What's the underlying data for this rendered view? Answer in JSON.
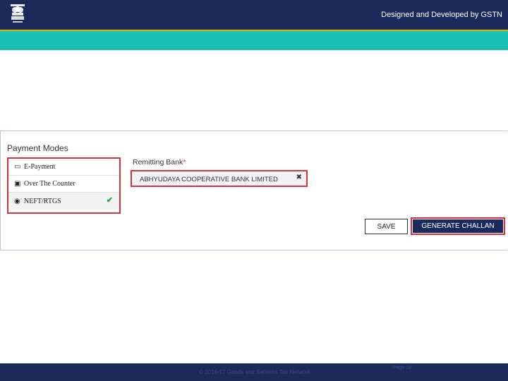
{
  "header": {
    "credit": "Designed and Developed by GSTN"
  },
  "payment": {
    "title": "Payment Modes",
    "modes": [
      {
        "icon": "card-icon",
        "label": "E-Payment"
      },
      {
        "icon": "counter-icon",
        "label": "Over The Counter"
      },
      {
        "icon": "radio-icon",
        "label": "NEFT/RTGS",
        "selected": true
      }
    ]
  },
  "bank": {
    "label": "Remitting Bank",
    "required_mark": "*",
    "value": "ABHYUDAYA COOPERATIVE BANK LIMITED",
    "clear": "✖"
  },
  "actions": {
    "save": "SAVE",
    "generate": "GENERATE CHALLAN"
  },
  "footer": {
    "text": "© 2016-17 Goods and Services Tax Network",
    "page": "Page 18"
  },
  "colors": {
    "header_bg": "#1b2a5a",
    "teal_bar": "#18c0b3",
    "highlight": "#d9323f",
    "check": "#2e9a3b"
  }
}
